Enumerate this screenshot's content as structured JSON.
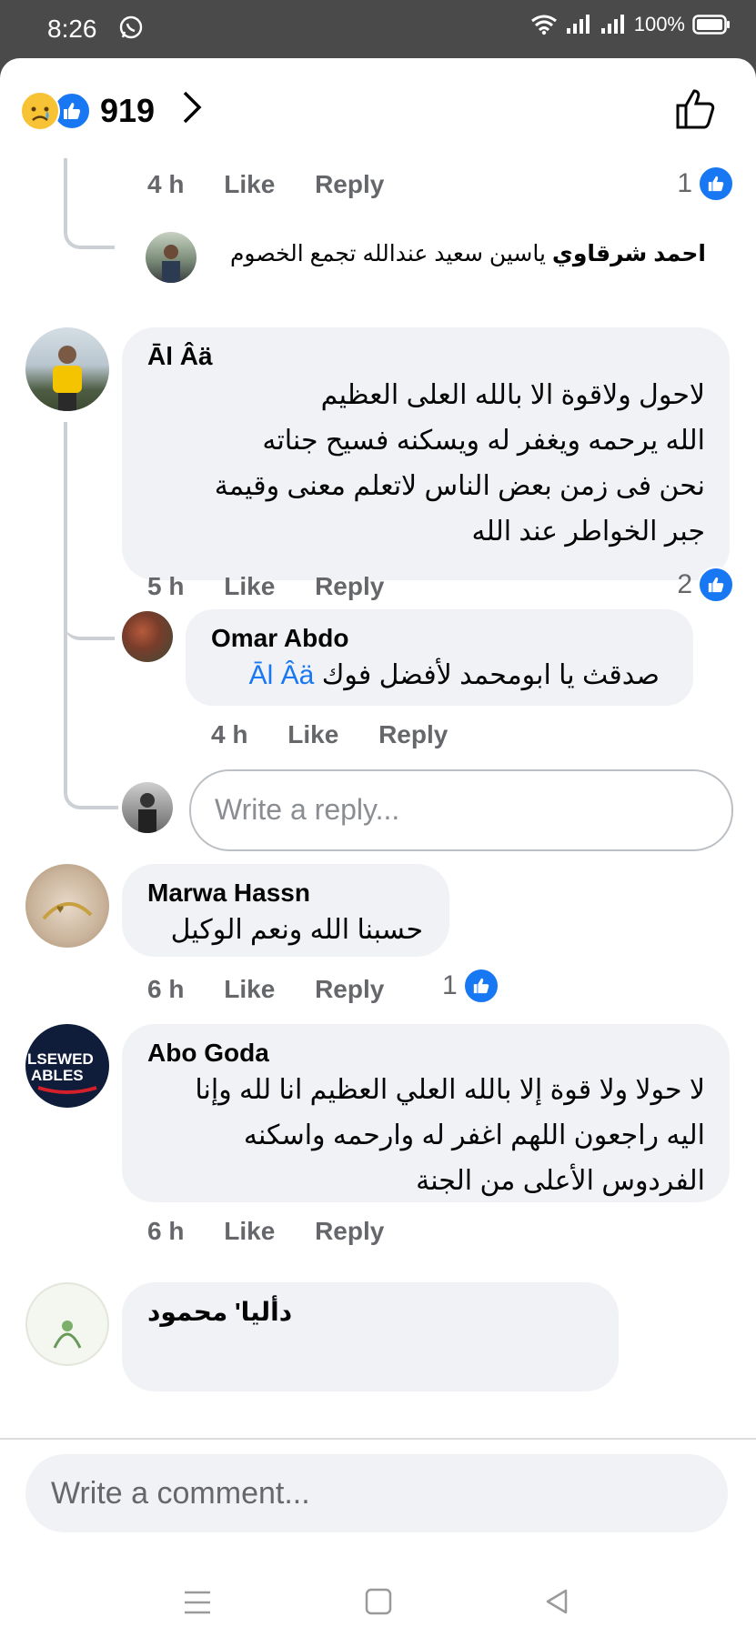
{
  "status": {
    "time": "8:26",
    "battery": "100%"
  },
  "header": {
    "reaction_count": "919"
  },
  "comments": {
    "c0": {
      "time": "4 h",
      "like": "Like",
      "reply": "Reply",
      "reactions": "1"
    },
    "c0_reply": {
      "mention": "احمد شرقاوي",
      "text": "ياسين سعيد عندالله تجمع الخصوم"
    },
    "c1": {
      "name": "Āl Âä",
      "lines": [
        "لاحول ولاقوة الا بالله العلى العظيم",
        "الله يرحمه ويغفر له ويسكنه فسيح جناته",
        "نحن فى زمن بعض الناس لاتعلم معنى وقيمة",
        "جبر الخواطر عند الله"
      ],
      "time": "5 h",
      "like": "Like",
      "reply": "Reply",
      "reactions": "2"
    },
    "c1_reply": {
      "name": "Omar Abdo",
      "text": "صدقث يا ابومحمد لأفضل فوك",
      "mention": "Āl Âä",
      "time": "4 h",
      "like": "Like",
      "reply": "Reply"
    },
    "reply_input": {
      "placeholder": "Write a reply..."
    },
    "c2": {
      "name": "Marwa Hassn",
      "text": "حسبنا الله ونعم الوكيل",
      "time": "6 h",
      "like": "Like",
      "reply": "Reply",
      "reactions": "1"
    },
    "c3": {
      "name": "Abo Goda",
      "avatar_text": [
        "LSEWED",
        "ABLES"
      ],
      "lines": [
        "لا حولا ولا قوة إلا بالله العلي العظيم انا لله وإنا",
        "اليه راجعون اللهم اغفر له وارحمه واسكنه",
        "الفردوس الأعلى من الجنة"
      ],
      "time": "6 h",
      "like": "Like",
      "reply": "Reply"
    },
    "c4": {
      "name": "دألیا' محمود"
    }
  },
  "footer": {
    "comment_placeholder": "Write a comment..."
  },
  "colors": {
    "accent": "#1877f2",
    "bubble": "#f0f2f5",
    "meta": "#65676b"
  }
}
